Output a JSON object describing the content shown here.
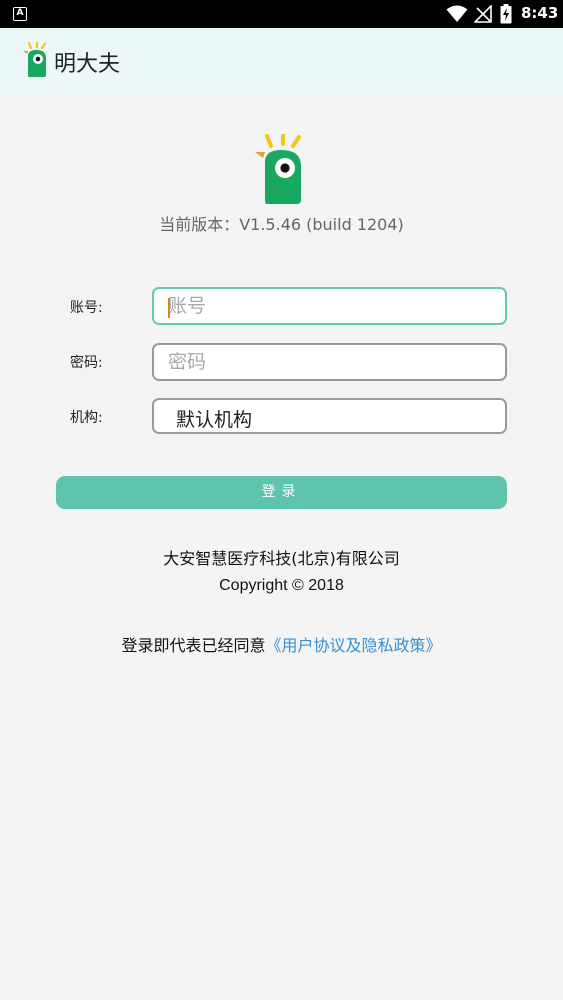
{
  "status_bar": {
    "app_icon_letter": "A",
    "time": "8:43",
    "icons": [
      "wifi-icon",
      "signal-off-icon",
      "battery-charging-icon"
    ]
  },
  "app_bar": {
    "title": "明大夫",
    "logo_icon": "bird-logo-icon"
  },
  "header": {
    "logo_icon": "bird-logo-icon",
    "version": "当前版本：V1.5.46 (build 1204)"
  },
  "form": {
    "account_label": "账号:",
    "account_placeholder": "账号",
    "account_value": "",
    "password_label": "密码:",
    "password_placeholder": "密码",
    "password_value": "",
    "org_label": "机构:",
    "org_value": "默认机构",
    "login_label": "登录"
  },
  "footer": {
    "company": "大安智慧医疗科技(北京)有限公司",
    "copyright": "Copyright © 2018",
    "agreement_prefix": "登录即代表已经同意",
    "agreement_link": "《用户协议及隐私政策》"
  },
  "colors": {
    "accent": "#5ec4ab",
    "focus_border": "#66c9b1",
    "link": "#3a8fd0",
    "logo_green": "#18a860",
    "logo_yellow": "#f5c518"
  }
}
